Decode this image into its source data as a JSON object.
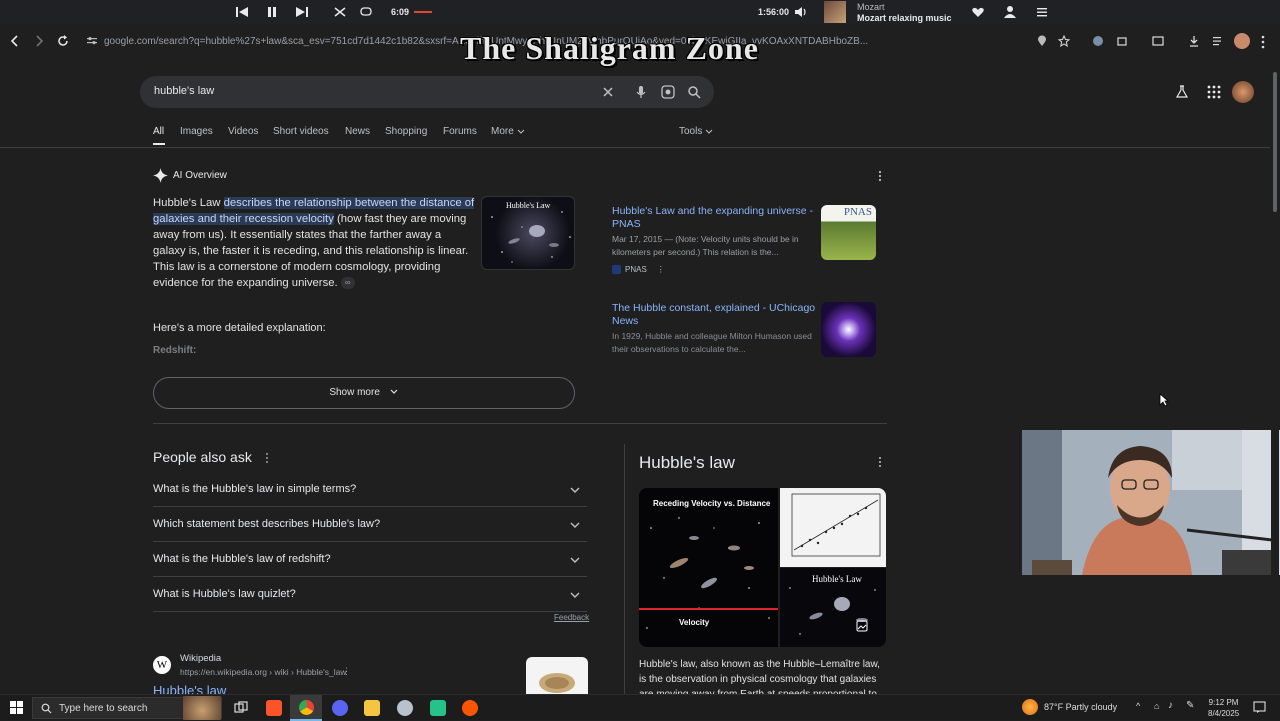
{
  "media": {
    "time_elapsed": "6:09",
    "time_total": "1:56:00",
    "artist": "Mozart",
    "track": "Mozart relaxing music"
  },
  "browser": {
    "url": "google.com/search?q=hubble%27s+law&sca_esv=751cd7d1442c1b82&sxsrf=AE3TifF-UntMwyqPh...InUM2ZwhbPurOUiAo&ved=0ahUKEwiGIIa_vvKOAxXNTDABHboZB..."
  },
  "watermark": "The Shaligram Zone",
  "search": {
    "query": "hubble's law"
  },
  "tabs": [
    "All",
    "Images",
    "Videos",
    "Short videos",
    "News",
    "Shopping",
    "Forums",
    "More",
    "Tools"
  ],
  "ai_overview": {
    "label": "AI Overview",
    "text_plain_start": "Hubble's Law ",
    "text_highlight": "describes the relationship between the distance of galaxies and their recession velocity",
    "text_rest": " (how fast they are moving away from us). It essentially states that the farther away a galaxy is, the faster it is receding, and this relationship is linear. This law is a cornerstone of modern cosmology, providing evidence for the expanding universe.",
    "image_title": "Hubble's Law",
    "more_heading": "Here's a more detailed explanation:",
    "subheading": "Redshift:",
    "show_more": "Show more",
    "sources": [
      {
        "title": "Hubble's Law and the expanding universe - PNAS",
        "meta": "Mar 17, 2015 — (Note: Velocity units should be in kilometers per second.) This relation is the...",
        "publisher": "PNAS",
        "thumb_label": "PNAS"
      },
      {
        "title": "The Hubble constant, explained - UChicago News",
        "meta": "In 1929, Hubble and colleague Milton Humason used their observations to calculate the..."
      }
    ]
  },
  "paa": {
    "title": "People also ask",
    "questions": [
      "What is the Hubble's law in simple terms?",
      "Which statement best describes Hubble's law?",
      "What is the Hubble's law of redshift?",
      "What is Hubble's law quizlet?"
    ],
    "feedback": "Feedback"
  },
  "knowledge_panel": {
    "title": "Hubble's law",
    "img1_caption": "Receding Velocity vs. Distance",
    "img1_bottom": "Velocity",
    "img3_caption": "Hubble's Law",
    "description": "Hubble's law, also known as the Hubble–Lemaître law, is the observation in physical cosmology that galaxies are moving away from Earth at speeds proportional to their..."
  },
  "wiki": {
    "name": "Wikipedia",
    "url": "https://en.wikipedia.org › wiki › Hubble's_law",
    "title": "Hubble's law"
  },
  "taskbar": {
    "search_placeholder": "Type here to search",
    "weather": "87°F  Partly cloudy",
    "time": "9:12 PM",
    "date": "8/4/2025"
  },
  "colors": {
    "link": "#8ab4f8",
    "background": "#1f1f1f",
    "highlight": "#2b3a55"
  }
}
